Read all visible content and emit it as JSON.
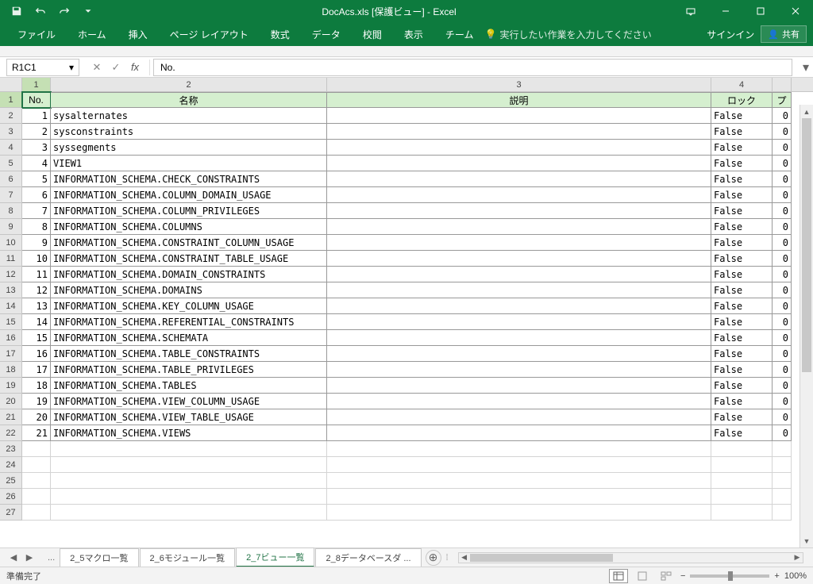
{
  "window": {
    "title": "DocAcs.xls  [保護ビュー] - Excel",
    "signin": "サインイン",
    "share": "共有"
  },
  "tabs": {
    "file": "ファイル",
    "home": "ホーム",
    "insert": "挿入",
    "page_layout": "ページ レイアウト",
    "formulas": "数式",
    "data": "データ",
    "review": "校閲",
    "view": "表示",
    "team": "チーム",
    "tell_me": "実行したい作業を入力してください"
  },
  "formula": {
    "name_box": "R1C1",
    "fx": "fx",
    "value": "No."
  },
  "columns": {
    "c1": "1",
    "c2": "2",
    "c3": "3",
    "c4": "4"
  },
  "headers": {
    "no": "No.",
    "name": "名称",
    "desc": "説明",
    "lock": "ロック",
    "pr": "プ"
  },
  "rows": [
    {
      "no": "1",
      "name": "sysalternates",
      "lock": "False",
      "pr": "0"
    },
    {
      "no": "2",
      "name": "sysconstraints",
      "lock": "False",
      "pr": "0"
    },
    {
      "no": "3",
      "name": "syssegments",
      "lock": "False",
      "pr": "0"
    },
    {
      "no": "4",
      "name": "VIEW1",
      "lock": "False",
      "pr": "0"
    },
    {
      "no": "5",
      "name": "INFORMATION_SCHEMA.CHECK_CONSTRAINTS",
      "lock": "False",
      "pr": "0"
    },
    {
      "no": "6",
      "name": "INFORMATION_SCHEMA.COLUMN_DOMAIN_USAGE",
      "lock": "False",
      "pr": "0"
    },
    {
      "no": "7",
      "name": "INFORMATION_SCHEMA.COLUMN_PRIVILEGES",
      "lock": "False",
      "pr": "0"
    },
    {
      "no": "8",
      "name": "INFORMATION_SCHEMA.COLUMNS",
      "lock": "False",
      "pr": "0"
    },
    {
      "no": "9",
      "name": "INFORMATION_SCHEMA.CONSTRAINT_COLUMN_USAGE",
      "lock": "False",
      "pr": "0"
    },
    {
      "no": "10",
      "name": "INFORMATION_SCHEMA.CONSTRAINT_TABLE_USAGE",
      "lock": "False",
      "pr": "0"
    },
    {
      "no": "11",
      "name": "INFORMATION_SCHEMA.DOMAIN_CONSTRAINTS",
      "lock": "False",
      "pr": "0"
    },
    {
      "no": "12",
      "name": "INFORMATION_SCHEMA.DOMAINS",
      "lock": "False",
      "pr": "0"
    },
    {
      "no": "13",
      "name": "INFORMATION_SCHEMA.KEY_COLUMN_USAGE",
      "lock": "False",
      "pr": "0"
    },
    {
      "no": "14",
      "name": "INFORMATION_SCHEMA.REFERENTIAL_CONSTRAINTS",
      "lock": "False",
      "pr": "0"
    },
    {
      "no": "15",
      "name": "INFORMATION_SCHEMA.SCHEMATA",
      "lock": "False",
      "pr": "0"
    },
    {
      "no": "16",
      "name": "INFORMATION_SCHEMA.TABLE_CONSTRAINTS",
      "lock": "False",
      "pr": "0"
    },
    {
      "no": "17",
      "name": "INFORMATION_SCHEMA.TABLE_PRIVILEGES",
      "lock": "False",
      "pr": "0"
    },
    {
      "no": "18",
      "name": "INFORMATION_SCHEMA.TABLES",
      "lock": "False",
      "pr": "0"
    },
    {
      "no": "19",
      "name": "INFORMATION_SCHEMA.VIEW_COLUMN_USAGE",
      "lock": "False",
      "pr": "0"
    },
    {
      "no": "20",
      "name": "INFORMATION_SCHEMA.VIEW_TABLE_USAGE",
      "lock": "False",
      "pr": "0"
    },
    {
      "no": "21",
      "name": "INFORMATION_SCHEMA.VIEWS",
      "lock": "False",
      "pr": "0"
    }
  ],
  "sheets": {
    "s1": "2_5マクロ一覧",
    "s2": "2_6モジュール一覧",
    "s3": "2_7ビュー一覧",
    "s4": "2_8データベースダ"
  },
  "status": {
    "ready": "準備完了",
    "zoom": "100%"
  }
}
